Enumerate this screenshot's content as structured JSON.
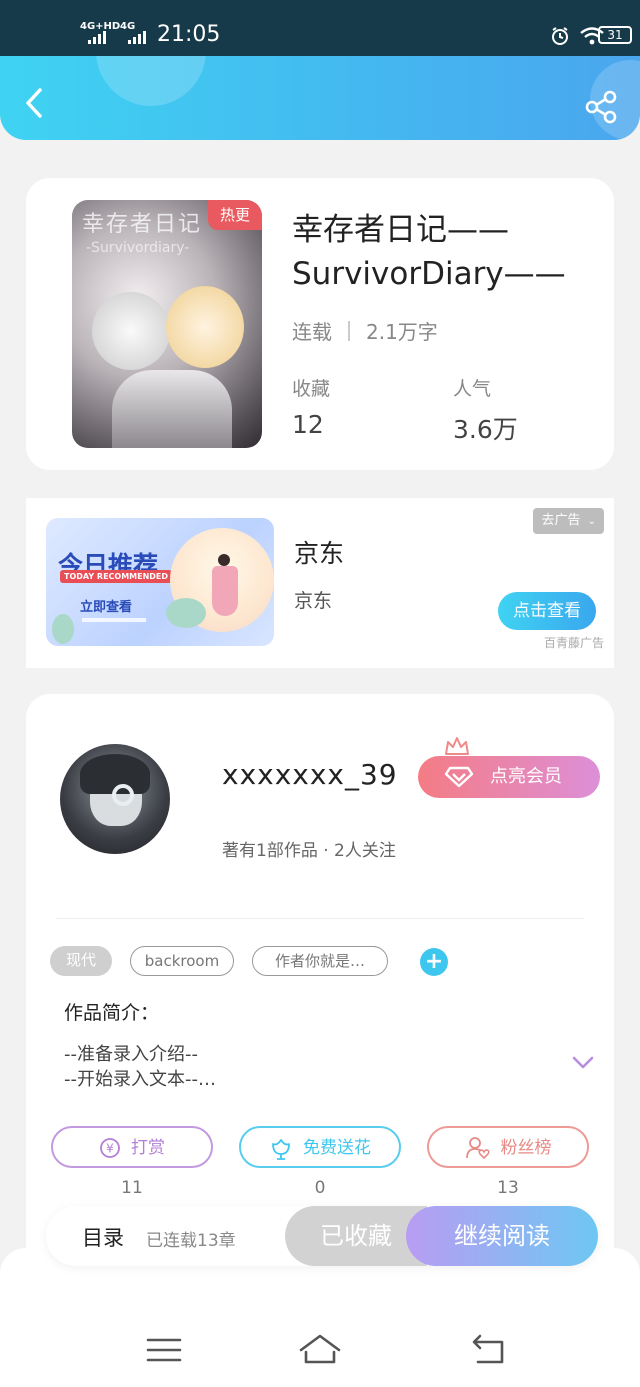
{
  "status_bar": {
    "network1": "4G+HD",
    "network2": "4G",
    "time": "21:05",
    "battery": "31",
    "icons": [
      "alarm-icon",
      "wifi-icon",
      "battery-icon"
    ]
  },
  "header": {
    "back_icon": "back-arrow-icon",
    "share_icon": "share-icon",
    "gradient_colors": [
      "#3fd3f2",
      "#4aa6ee"
    ]
  },
  "book": {
    "cover_title": "幸存者日记",
    "cover_subtitle": "-Survivordiary-",
    "badge": "热更",
    "title": "幸存者日记——SurvivorDiary——",
    "status": "连载",
    "word_count": "2.1万字",
    "stats": [
      {
        "label": "收藏",
        "value": "12"
      },
      {
        "label": "人气",
        "value": "3.6万"
      }
    ]
  },
  "ad": {
    "image_title": "今日推荐",
    "image_subtitle": "TODAY RECOMMENDED",
    "image_button": "立即查看",
    "remove_label": "去广告",
    "title": "京东",
    "subtitle": "京东",
    "button_label": "点击查看",
    "source": "百青藤广告"
  },
  "author": {
    "name": "xxxxxxx_39",
    "vip_label": "点亮会员",
    "info": "著有1部作品 · 2人关注",
    "tags": [
      "现代",
      "backroom",
      "作者你就是…"
    ],
    "intro_label": "作品简介：",
    "intro_lines": [
      "--准备录入介绍--",
      "--开始录入文本--…"
    ]
  },
  "actions": [
    {
      "label": "打赏",
      "icon": "yen-coin-icon",
      "count": "11",
      "color": "#b37fd6"
    },
    {
      "label": "免费送花",
      "icon": "flower-icon",
      "count": "0",
      "color": "#3ec7ee"
    },
    {
      "label": "粉丝榜",
      "icon": "fan-heart-icon",
      "count": "13",
      "color": "#e88a86"
    }
  ],
  "bottom_bar": {
    "toc_label": "目录",
    "chapter_info": "已连载13章",
    "collected_label": "已收藏",
    "continue_label": "继续阅读"
  },
  "nav": {
    "icons": [
      "menu-icon",
      "home-icon",
      "back-icon"
    ]
  }
}
